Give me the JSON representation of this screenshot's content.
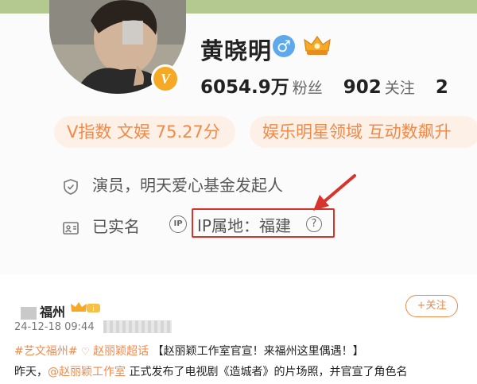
{
  "profile": {
    "name": "黄晓明",
    "verified_badge": "V",
    "gender": "male",
    "gender_symbol": "♂",
    "fans_count": "6054.9万",
    "fans_label": "粉丝",
    "following_count": "902",
    "following_label": "关注",
    "third_stat_partial": "2"
  },
  "pills": [
    {
      "text": "V指数 文娱 75.27分"
    },
    {
      "text": "娱乐明星领域 互动数飙升"
    }
  ],
  "info": {
    "bio": "演员，明天爱心基金发起人",
    "verify_status": "已实名",
    "ip_circle": "IP",
    "ip_location": "IP属地：福建",
    "help_symbol": "?"
  },
  "post": {
    "username": "福州",
    "follow_label": "+关注",
    "timestamp": "24-12-18 09:44",
    "tag": "#艺文福州#",
    "supertopic": "赵丽颖超话",
    "headline": "【赵丽颖工作室官宣！来福州这里偶遇！】",
    "line2_prefix": "昨天，",
    "line2_mention": "@赵丽颖工作室",
    "line2_rest": " 正式发布了电视剧《造城者》的片场照，并官宣了角色名"
  },
  "colors": {
    "accent_orange": "#f08a4b",
    "pill_bg": "#fdf0e6",
    "highlight_red": "#d9342b",
    "gender_blue": "#5ea9ec",
    "vip_gold": "#f6a925",
    "top_strip": "#b3c98f"
  },
  "icons": [
    "shield-icon",
    "id-card-icon",
    "ip-icon",
    "help-icon",
    "crown-icon",
    "arrow-icon",
    "heart-icon"
  ]
}
